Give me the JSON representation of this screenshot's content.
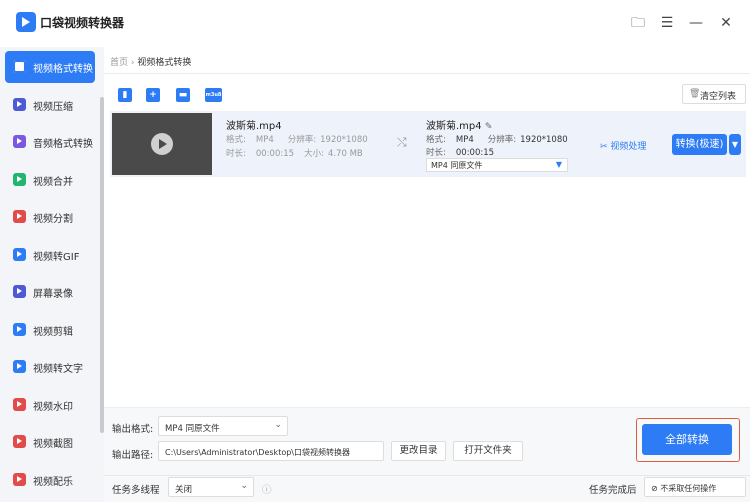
{
  "app": {
    "title": "口袋视频转换器"
  },
  "window_icons": [
    "folder-icon",
    "menu-icon",
    "minimize-icon",
    "close-icon"
  ],
  "window_glyphs": {
    "folder": "🗀",
    "menu": "☰",
    "minimize": "—",
    "close": "✕"
  },
  "sidebar": {
    "items": [
      {
        "label": "视频格式转换",
        "color": "#ffffff",
        "active": true
      },
      {
        "label": "视频压缩",
        "color": "#4c5bd4"
      },
      {
        "label": "音频格式转换",
        "color": "#7b58e0"
      },
      {
        "label": "视频合并",
        "color": "#21b66e"
      },
      {
        "label": "视频分割",
        "color": "#e34a4a"
      },
      {
        "label": "视频转GIF",
        "color": "#2d7cf6"
      },
      {
        "label": "屏幕录像",
        "color": "#4c5bd4"
      },
      {
        "label": "视频剪辑",
        "color": "#2d7cf6"
      },
      {
        "label": "视频转文字",
        "color": "#2d7cf6"
      },
      {
        "label": "视频水印",
        "color": "#e34a4a"
      },
      {
        "label": "视频截图",
        "color": "#e34a4a"
      },
      {
        "label": "视频配乐",
        "color": "#e34a4a"
      }
    ]
  },
  "breadcrumb": {
    "home": "首页",
    "sep": "›",
    "current": "视频格式转换"
  },
  "toolbar": {
    "buttons": [
      {
        "icon": "add-file-icon",
        "glyph": "▮"
      },
      {
        "icon": "add-folder-icon",
        "glyph": "+"
      },
      {
        "icon": "open-folder-icon",
        "glyph": "▬"
      },
      {
        "icon": "m3u8-icon",
        "glyph": "m3u8"
      }
    ],
    "clear_icon": "🗑",
    "clear_label": "清空列表"
  },
  "file": {
    "source": {
      "name": "波斯菊.mp4",
      "format_label": "格式:",
      "format": "MP4",
      "res_label": "分辨率:",
      "resolution": "1920*1080",
      "duration_label": "时长:",
      "duration": "00:00:15",
      "size_label": "大小:",
      "size": "4.70 MB"
    },
    "output": {
      "name": "波斯菊.mp4",
      "edit_glyph": "✎",
      "format_label": "格式:",
      "format": "MP4",
      "res_label": "分辨率:",
      "resolution": "1920*1080",
      "duration_label": "时长:",
      "duration": "00:00:15",
      "preset": "MP4  同原文件",
      "preset_arrow": "▼"
    },
    "shuffle_glyph": "⤭",
    "process_label": "视频处理",
    "process_glyph": "✂",
    "convert_label": "转换(极速)",
    "convert_more": "▼"
  },
  "bottom": {
    "output_format_label": "输出格式:",
    "output_format": "MP4  同原文件",
    "output_path_label": "输出路径:",
    "output_path": "C:\\Users\\Administrator\\Desktop\\口袋视频转换器",
    "change_dir": "更改目录",
    "open_folder": "打开文件夹",
    "convert_all": "全部转换",
    "multithread_label": "任务多线程",
    "multithread_value": "关闭",
    "info_glyph": "ⓘ",
    "after_done_label": "任务完成后",
    "after_done_value": "⊘ 不采取任何操作",
    "arrow": "⌄"
  }
}
